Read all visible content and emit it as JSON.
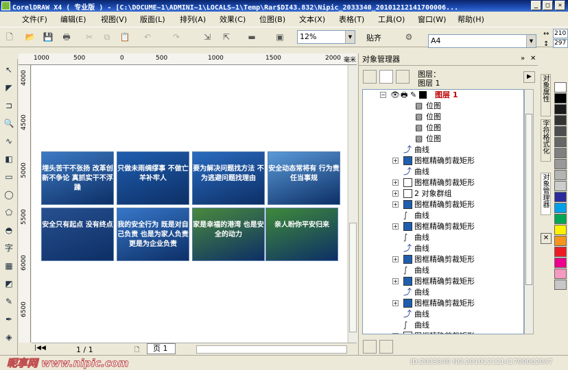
{
  "window": {
    "title": "CorelDRAW X4 ( 专业版 ) - [C:\\DOCUME~1\\ADMINI~1\\LOCALS~1\\Temp\\Rar$DI43.832\\Nipic_2033340_20101212141700006..."
  },
  "menu": [
    "文件(F)",
    "编辑(E)",
    "视图(V)",
    "版面(L)",
    "排列(A)",
    "效果(C)",
    "位图(B)",
    "文本(X)",
    "表格(T)",
    "工具(O)",
    "窗口(W)",
    "帮助(H)"
  ],
  "toolbar": {
    "zoom": "12%",
    "snap": "贴齐",
    "paper": "A4",
    "width": "210",
    "height": "297"
  },
  "ruler": {
    "h": [
      "1000",
      "500",
      "0",
      "500",
      "1000",
      "1500",
      "2000",
      "毫米"
    ],
    "v": [
      "4000",
      "4500",
      "5000",
      "5500",
      "6000",
      "6500"
    ]
  },
  "slides": [
    {
      "text": "埋头苦干不张扬 改革创新不争论 真抓实干不浮躁",
      "bg": "#3d7bc4"
    },
    {
      "text": "只做未雨绸缪事 不做亡羊补牢人",
      "bg": "#1f5eaf"
    },
    {
      "text": "要为解决问题找方法 不为逃避问题找理由",
      "bg": "#2a6bc0"
    },
    {
      "text": "安全动态常将有 行为责任当事规",
      "bg": "#5a9ad8"
    },
    {
      "text": "安全只有起点 没有终点",
      "bg": "#27508f"
    },
    {
      "text": "我的安全行为 既是对自己负责 也是为家人负责 更是为企业负责",
      "bg": "#3777c9"
    },
    {
      "text": "家是幸福的港湾 也是安全的动力",
      "bg": "#4a8a3c"
    },
    {
      "text": "亲人盼你平安归来",
      "bg": "#3f8a3a"
    }
  ],
  "page_nav": {
    "count": "1 / 1",
    "tab": "页 1"
  },
  "panel": {
    "title": "对象管理器",
    "layer_label": "图层：",
    "layer_name": "图层 1",
    "root": "图层 1"
  },
  "tree": [
    {
      "text": "位图",
      "icon": "bitmap",
      "indent": 1
    },
    {
      "text": "位图",
      "icon": "bitmap",
      "indent": 1
    },
    {
      "text": "位图",
      "icon": "bitmap",
      "indent": 1
    },
    {
      "text": "位图",
      "icon": "bitmap",
      "indent": 1
    },
    {
      "text": "曲线",
      "icon": "curve",
      "indent": 0
    },
    {
      "text": "图框精确剪裁矩形",
      "icon": "rect",
      "indent": 0,
      "exp": true
    },
    {
      "text": "曲线",
      "icon": "curve",
      "indent": 0
    },
    {
      "text": "图框精确剪裁矩形",
      "icon": "rect-white",
      "indent": 0,
      "exp": true
    },
    {
      "text": "2 对象群组",
      "icon": "group",
      "indent": 0,
      "exp": true
    },
    {
      "text": "图框精确剪裁矩形",
      "icon": "rect",
      "indent": 0,
      "exp": true
    },
    {
      "text": "曲线",
      "icon": "curve-line",
      "indent": 0
    },
    {
      "text": "图框精确剪裁矩形",
      "icon": "rect",
      "indent": 0,
      "exp": true
    },
    {
      "text": "曲线",
      "icon": "curve-line",
      "indent": 0
    },
    {
      "text": "曲线",
      "icon": "curve",
      "indent": 0
    },
    {
      "text": "图框精确剪裁矩形",
      "icon": "rect",
      "indent": 0,
      "exp": true
    },
    {
      "text": "曲线",
      "icon": "curve-line",
      "indent": 0
    },
    {
      "text": "图框精确剪裁矩形",
      "icon": "rect",
      "indent": 0,
      "exp": true
    },
    {
      "text": "曲线",
      "icon": "curve",
      "indent": 0
    },
    {
      "text": "图框精确剪裁矩形",
      "icon": "rect",
      "indent": 0,
      "exp": true
    },
    {
      "text": "曲线",
      "icon": "curve",
      "indent": 0
    },
    {
      "text": "曲线",
      "icon": "curve-line",
      "indent": 0
    },
    {
      "text": "图框精确剪裁矩形",
      "icon": "rect-white",
      "indent": 0,
      "exp": true
    }
  ],
  "side_tabs": [
    "对象属性",
    "字符格式化",
    "对象管理器"
  ],
  "palette": [
    "#ffffff",
    "#000000",
    "#1a1a1a",
    "#333333",
    "#4d4d4d",
    "#666666",
    "#808080",
    "#999999",
    "#b3b3b3",
    "#cccccc",
    "#2b2b9b",
    "#00a0e9",
    "#00a651",
    "#fff200",
    "#f7941d",
    "#ed1c24",
    "#ec008c",
    "#f49ac1",
    "#c7c7c7"
  ],
  "watermark": {
    "left": "昵享网 www.nipic.com",
    "right": "ID:2033340 NO:20101212141700062047"
  }
}
